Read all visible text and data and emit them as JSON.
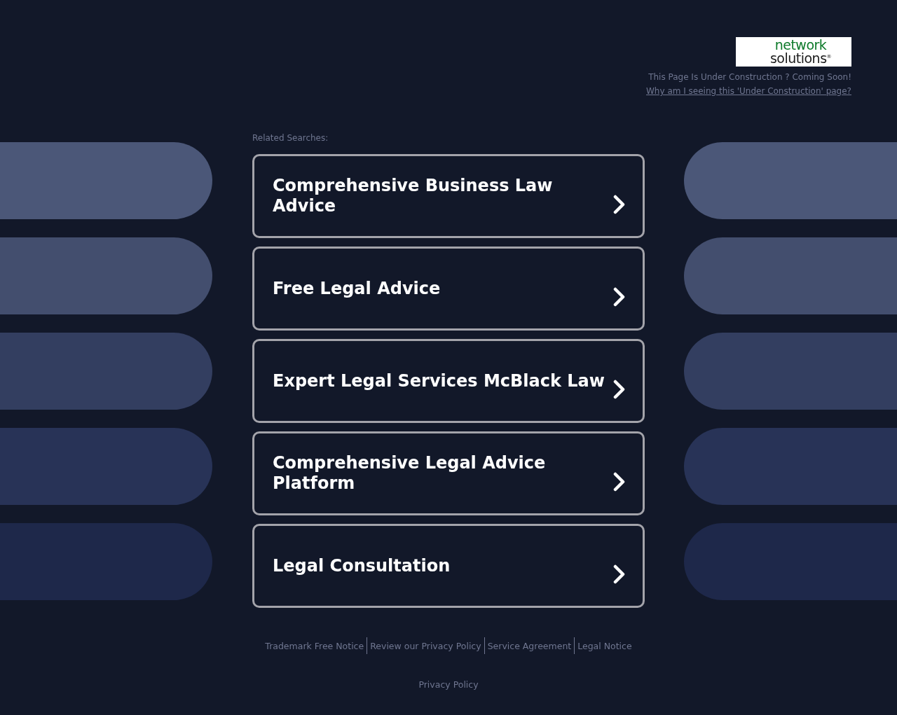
{
  "header": {
    "logo_lines": [
      "network",
      "solutions$^{®}$"
    ],
    "notice": "This Page Is Under Construction ? Coming Soon!",
    "why_link": "Why am I seeing this 'Under Construction' page?"
  },
  "related": {
    "title": "Related Searches:",
    "items": [
      {
        "label": "Comprehensive Business Law Advice"
      },
      {
        "label": "Free Legal Advice"
      },
      {
        "label": "Expert Legal Services McBlack Law"
      },
      {
        "label": "Comprehensive Legal Advice Platform"
      },
      {
        "label": "Legal Consultation"
      }
    ]
  },
  "footer": {
    "links": [
      "Trademark Free Notice",
      "Review our Privacy Policy",
      "Service Agreement",
      "Legal Notice"
    ],
    "privacy": "Privacy Policy"
  }
}
